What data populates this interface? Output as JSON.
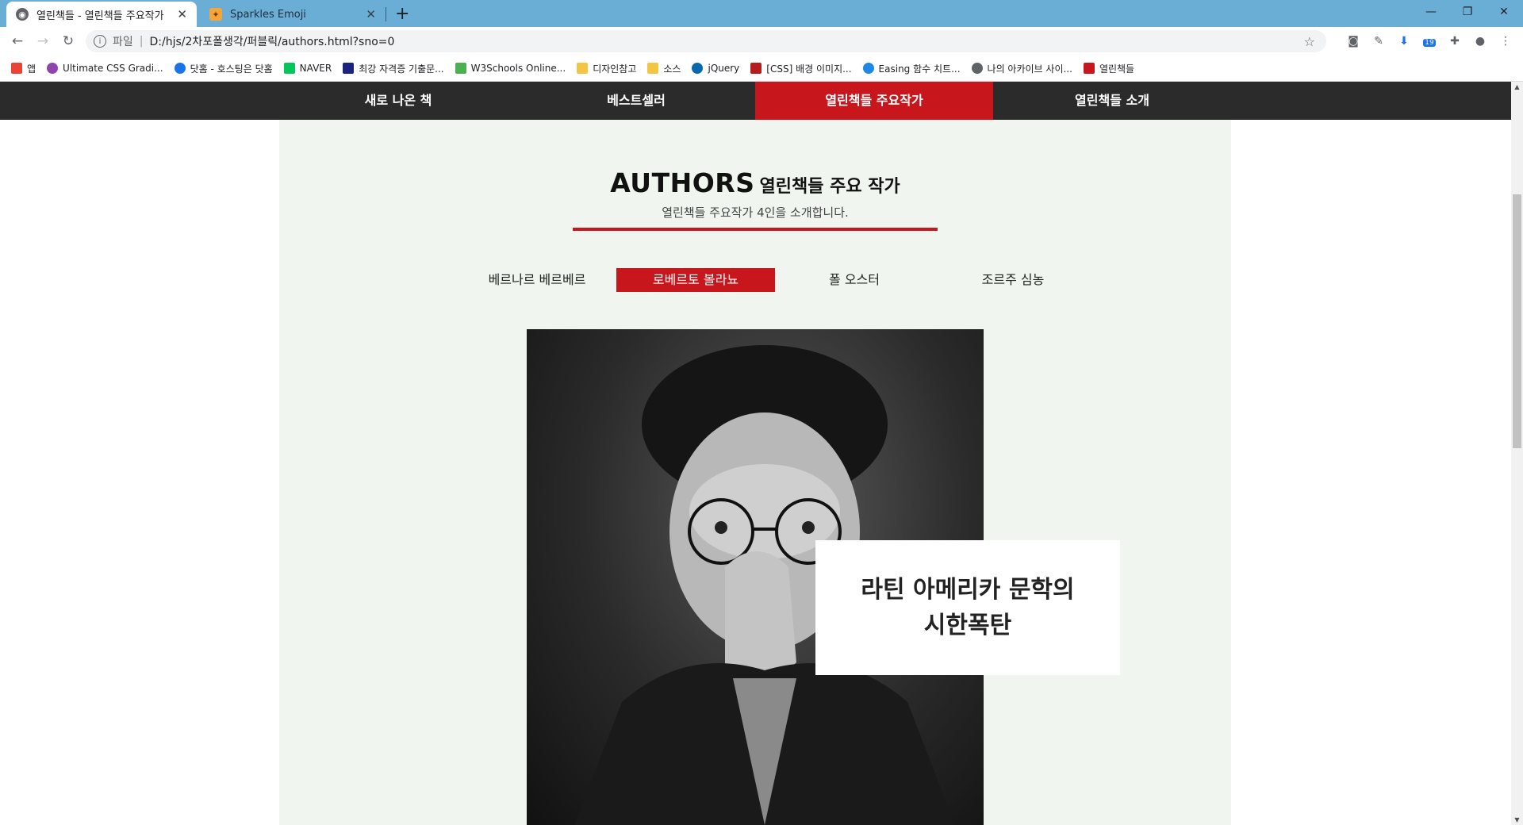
{
  "browser": {
    "tabs": [
      {
        "title": "열린책들 - 열린책들 주요작가",
        "active": true
      },
      {
        "title": "Sparkles Emoji",
        "active": false
      }
    ],
    "address": {
      "scheme_label": "파일",
      "url": "D:/hjs/2차포폴생각/퍼블릭/authors.html?sno=0"
    },
    "bookmarks": [
      {
        "label": "앱",
        "color": "#ea4335"
      },
      {
        "label": "Ultimate CSS Gradi...",
        "color": "#8e44ad"
      },
      {
        "label": "닷홈 - 호스팅은 닷홈",
        "color": "#1a73e8"
      },
      {
        "label": "NAVER",
        "color": "#03c75a"
      },
      {
        "label": "최강 자격증 기출문...",
        "color": "#1a237e"
      },
      {
        "label": "W3Schools Online...",
        "color": "#4caf50"
      },
      {
        "label": "디자인참고",
        "color": "#f4c542"
      },
      {
        "label": "소스",
        "color": "#f4c542"
      },
      {
        "label": "jQuery",
        "color": "#0769ad"
      },
      {
        "label": "[CSS] 배경 이미지...",
        "color": "#b71c1c"
      },
      {
        "label": "Easing 함수 치트...",
        "color": "#1e88e5"
      },
      {
        "label": "나의 아카이브 사이...",
        "color": "#5f6368"
      },
      {
        "label": "열린책들",
        "color": "#c8161d"
      }
    ],
    "extension_badge": "19"
  },
  "site": {
    "menu": [
      {
        "label": "새로 나온 책",
        "active": false
      },
      {
        "label": "베스트셀러",
        "active": false
      },
      {
        "label": "열린책들 주요작가",
        "active": true
      },
      {
        "label": "열린책들 소개",
        "active": false
      }
    ],
    "heading_en": "AUTHORS",
    "heading_ko": "열린책들 주요 작가",
    "subtitle": "열린책들 주요작가 4인을 소개합니다.",
    "author_tabs": [
      {
        "label": "베르나르 베르베르",
        "active": false
      },
      {
        "label": "로베르토 볼라뇨",
        "active": true
      },
      {
        "label": "폴 오스터",
        "active": false
      },
      {
        "label": "조르주 심농",
        "active": false
      }
    ],
    "caption_lines": [
      "라틴 아메리카 문학의",
      "시한폭탄"
    ],
    "accent_color": "#c8161d",
    "nav_color": "#2b2b2b",
    "content_bg": "#f0f5f0"
  }
}
